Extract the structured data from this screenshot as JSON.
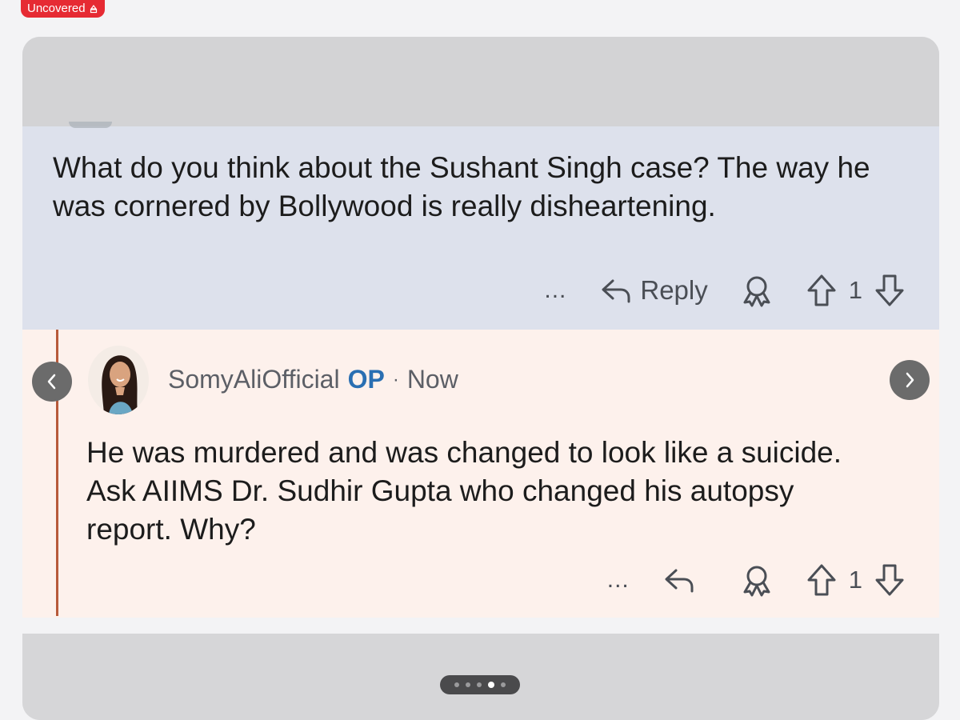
{
  "badge": {
    "label": "Uncovered"
  },
  "parent_comment": {
    "body": "What do you think about the Sushant Singh case? The way he was cornered by Bollywood is really disheartening.",
    "actions": {
      "more": "...",
      "reply_label": "Reply",
      "vote_count": "1"
    }
  },
  "reply_comment": {
    "username": "SomyAliOfficial",
    "op_tag": "OP",
    "separator": "·",
    "timestamp": "Now",
    "body": "He was murdered and was changed to look like a suicide. Ask AIIMS Dr. Sudhir Gupta who changed his autopsy report. Why?",
    "actions": {
      "more": "...",
      "vote_count": "1"
    }
  },
  "carousel": {
    "page_count": 5,
    "active_index": 3
  },
  "icons": {
    "reply": "reply-arrow-icon",
    "award": "award-icon",
    "upvote": "upvote-arrow-icon",
    "downvote": "downvote-arrow-icon",
    "prev": "chevron-left-icon",
    "next": "chevron-right-icon"
  },
  "colors": {
    "badge": "#e62a33",
    "op_tag": "#2a6fb2",
    "thread_line": "#b75a3a",
    "parent_bg": "#dde1ec",
    "reply_bg": "#fdf1ec"
  }
}
